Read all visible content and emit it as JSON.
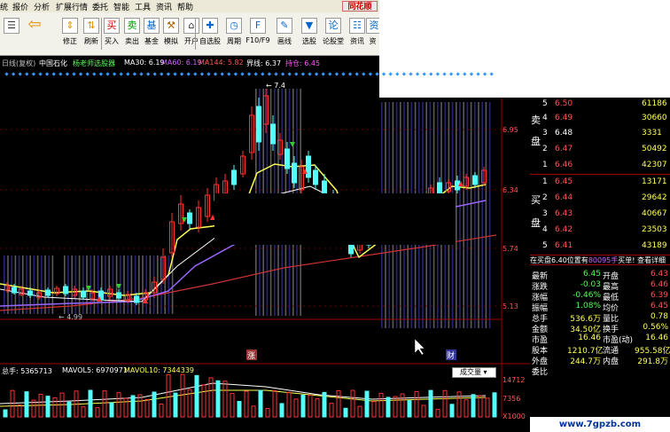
{
  "menu": [
    "统",
    "报价",
    "分析",
    "扩展行情",
    "委托",
    "智能",
    "工具",
    "资讯",
    "帮助"
  ],
  "brand": "同花顺",
  "toolbar": [
    "修正",
    "刷新",
    "买入",
    "卖出",
    "基金",
    "模拟",
    "开户",
    "自选股",
    "周期",
    "F10/F9",
    "画线",
    "选股",
    "论股堂",
    "资讯",
    "资"
  ],
  "info": {
    "mode": "日线(复权)",
    "stock": "中国石化",
    "tool": "杨老师选股器",
    "ma30": "MA30: 6.19",
    "ma60": "MA60: 6.19",
    "ma144": "MA144: 5.82",
    "jx": "界线: 6.37",
    "cc": "持仓: 6.45"
  },
  "axis": {
    "p1": "6.95",
    "p2": "6.34",
    "p3": "5.74",
    "p4": "5.13",
    "v1": "14712",
    "v2": "7356",
    "v3": "X1000"
  },
  "chart": {
    "high_label": "7.4",
    "low_label": "4.99",
    "zhang": "涨",
    "cai": "财"
  },
  "volume": {
    "total": "总手: 5365713",
    "mavol5": "MAVOL5: 6970971",
    "mavol10": "MAVOL10: 7344339",
    "selector": "成交量"
  },
  "orderbook": {
    "sell_label": "卖盘",
    "buy_label": "买盘",
    "sells": [
      {
        "n": "5",
        "p": "6.50",
        "v": "61186"
      },
      {
        "n": "4",
        "p": "6.49",
        "v": "30660"
      },
      {
        "n": "3",
        "p": "6.48",
        "v": "3331"
      },
      {
        "n": "2",
        "p": "6.47",
        "v": "50492"
      },
      {
        "n": "1",
        "p": "6.46",
        "v": "42307"
      }
    ],
    "buys": [
      {
        "n": "1",
        "p": "6.45",
        "v": "13171"
      },
      {
        "n": "2",
        "p": "6.44",
        "v": "29642"
      },
      {
        "n": "3",
        "p": "6.43",
        "v": "40667"
      },
      {
        "n": "4",
        "p": "6.42",
        "v": "23503"
      },
      {
        "n": "5",
        "p": "6.41",
        "v": "43189"
      }
    ],
    "status_left": "在买盘6.40位置有",
    "status_mid": "80095手",
    "status_right": "买单! 查看详细",
    "stats": [
      {
        "l1": "最新",
        "v1": "6.45",
        "l2": "开盘",
        "v2": "6.43"
      },
      {
        "l1": "涨跌",
        "v1": "-0.03",
        "l2": "最高",
        "v2": "6.46"
      },
      {
        "l1": "涨幅",
        "v1": "-0.46%",
        "l2": "最低",
        "v2": "6.39"
      },
      {
        "l1": "振幅",
        "v1": "1.08%",
        "l2": "均价",
        "v2": "6.45"
      },
      {
        "l1": "总手",
        "v1": "536.6万",
        "l2": "量比",
        "v2": "0.78"
      },
      {
        "l1": "金额",
        "v1": "34.50亿",
        "l2": "换手",
        "v2": "0.56%"
      },
      {
        "l1": "市盈",
        "v1": "16.46",
        "l2": "市盈(动)",
        "v2": "16.46"
      },
      {
        "l1": "股本",
        "v1": "1210.7亿",
        "l2": "流通",
        "v2": "955.58亿"
      },
      {
        "l1": "外盘",
        "v1": "244.7万",
        "l2": "内盘",
        "v2": "291.8万"
      },
      {
        "l1": "委比",
        "v1": "",
        "l2": "",
        "v2": ""
      }
    ]
  },
  "watermark": "www.7gpzb.com",
  "colors": {
    "up": "#ff3232",
    "down": "#54fcfc",
    "yellow": "#ffff54",
    "ma_purple": "#9966ff",
    "ma_red": "#cc3333"
  }
}
